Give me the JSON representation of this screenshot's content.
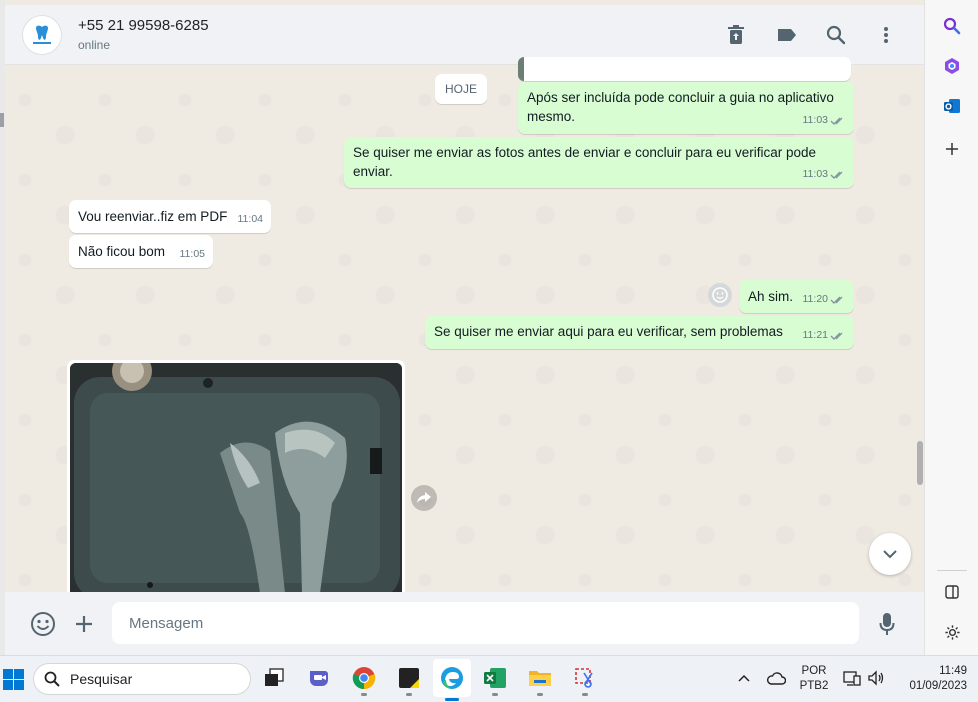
{
  "header": {
    "contact_name": "+55 21 99598-6285",
    "status": "online",
    "icons": [
      "delete-icon",
      "label-icon",
      "search-icon",
      "menu-icon"
    ]
  },
  "chat": {
    "date_chip": "HOJE",
    "messages": [
      {
        "dir": "out",
        "text": "Após ser incluída pode concluir a guia no aplicativo mesmo.",
        "time": "11:03"
      },
      {
        "dir": "out",
        "text": "Se quiser me enviar as fotos antes de enviar e concluir para eu verificar pode enviar.",
        "time": "11:03"
      },
      {
        "dir": "in",
        "text": "Vou reenviar..fiz em PDF",
        "time": "11:04"
      },
      {
        "dir": "in",
        "text": "Não ficou bom",
        "time": "11:05"
      },
      {
        "dir": "out",
        "text": "Ah sim.",
        "time": "11:20"
      },
      {
        "dir": "out",
        "text": "Se quiser me enviar aqui para eu verificar, sem problemas",
        "time": "11:21"
      }
    ]
  },
  "footer": {
    "input_placeholder": "Mensagem"
  },
  "taskbar": {
    "search_label": "Pesquisar",
    "language_top": "POR",
    "language_bottom": "PTB2",
    "clock_time": "11:49",
    "clock_date": "01/09/2023"
  },
  "colors": {
    "outgoing_bubble": "#d9fdd3",
    "incoming_bubble": "#ffffff",
    "chat_background": "#efeae2",
    "tick_read": "#53bdeb"
  }
}
